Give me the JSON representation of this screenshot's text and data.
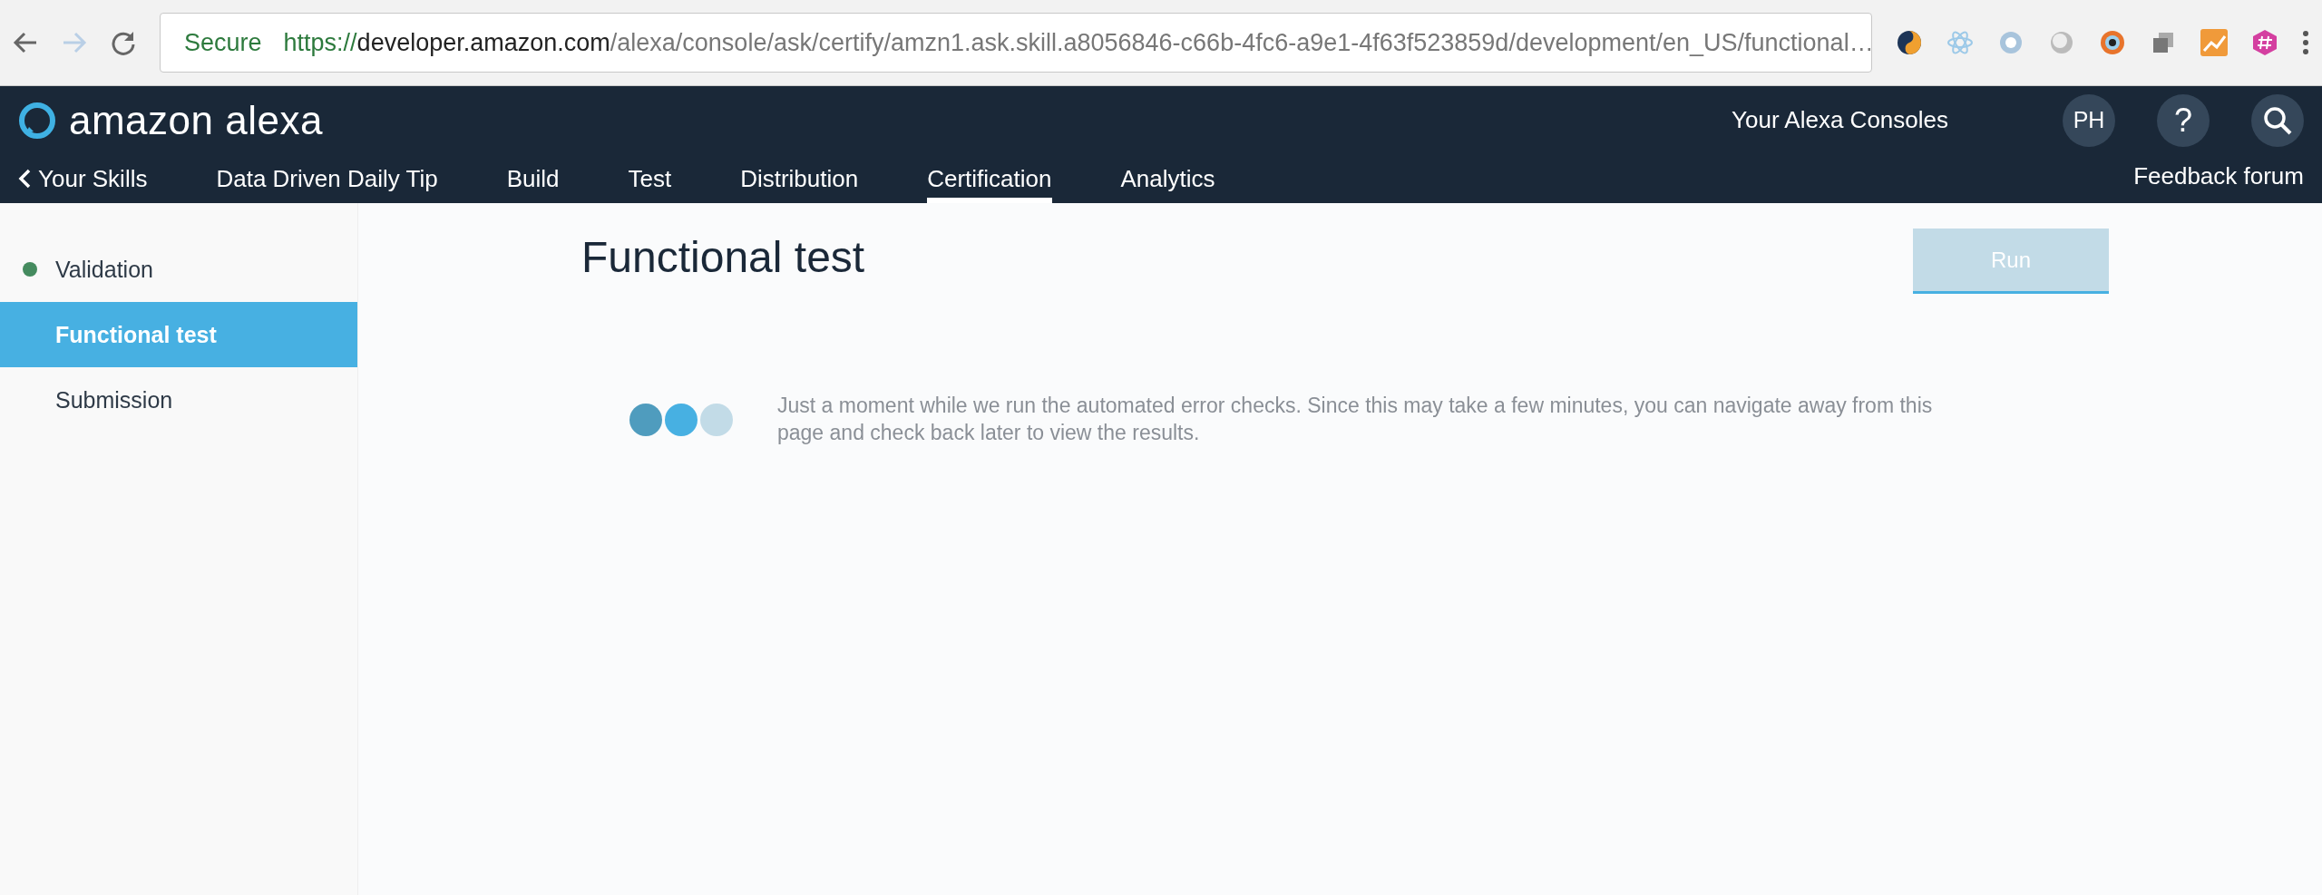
{
  "browser": {
    "secure_label": "Secure",
    "url_scheme": "https://",
    "url_host": "developer.amazon.com",
    "url_path": "/alexa/console/ask/certify/amzn1.ask.skill.a8056846-c66b-4fc6-a9e1-4f63f523859d/development/en_US/functional…"
  },
  "header": {
    "logo_text": "amazon alexa",
    "consoles_link": "Your Alexa Consoles",
    "avatar": "PH",
    "help": "?",
    "feedback_link": "Feedback forum"
  },
  "nav": [
    {
      "label": "Your Skills",
      "kind": "back",
      "selected": false
    },
    {
      "label": "Data Driven Daily Tip",
      "kind": "tab",
      "selected": false
    },
    {
      "label": "Build",
      "kind": "tab",
      "selected": false
    },
    {
      "label": "Test",
      "kind": "tab",
      "selected": false
    },
    {
      "label": "Distribution",
      "kind": "tab",
      "selected": false
    },
    {
      "label": "Certification",
      "kind": "tab",
      "selected": true
    },
    {
      "label": "Analytics",
      "kind": "tab",
      "selected": false
    }
  ],
  "sidebar": {
    "items": [
      {
        "label": "Validation",
        "selected": false,
        "color": "#458b5f"
      },
      {
        "label": "Functional test",
        "selected": true
      },
      {
        "label": "Submission",
        "selected": false
      }
    ]
  },
  "main": {
    "title": "Functional test",
    "run_button": {
      "label": "Run",
      "disabled": true
    },
    "message": "Just a moment while we run the automated error checks. Since this may take a few minutes, you can navigate away from this page and check back later to view the results."
  }
}
